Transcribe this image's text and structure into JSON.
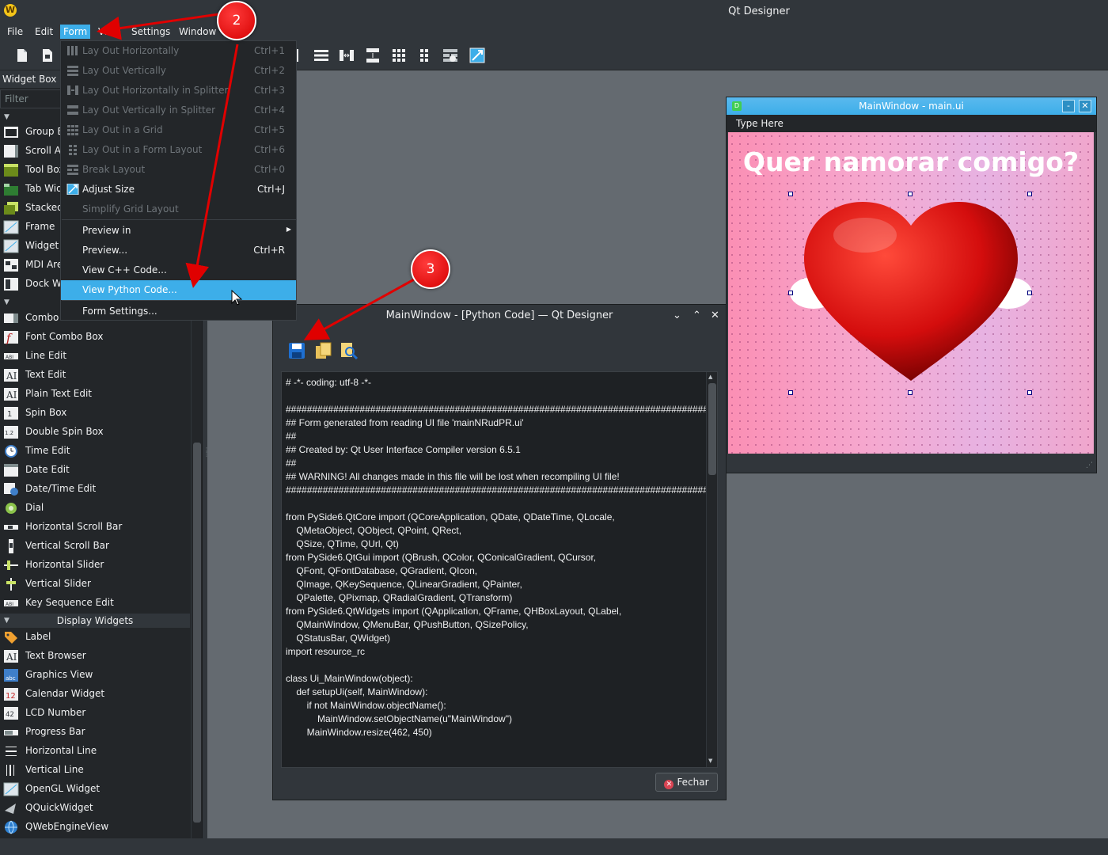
{
  "app": {
    "title": "Qt Designer",
    "icon": "qt-designer-icon"
  },
  "menubar": {
    "items": [
      "File",
      "Edit",
      "Form",
      "View",
      "Settings",
      "Window",
      "Help"
    ],
    "active": "Form"
  },
  "widget_box": {
    "title": "Widget Box",
    "filter_placeholder": "Filter",
    "items_top": [
      "Group Box",
      "Scroll Area",
      "Tool Box",
      "Tab Widget",
      "Stacked Widget",
      "Frame",
      "Widget",
      "MDI Area",
      "Dock Widget"
    ],
    "items_input": [
      "Combo Box",
      "Font Combo Box",
      "Line Edit",
      "Text Edit",
      "Plain Text Edit",
      "Spin Box",
      "Double Spin Box",
      "Time Edit",
      "Date Edit",
      "Date/Time Edit",
      "Dial",
      "Horizontal Scroll Bar",
      "Vertical Scroll Bar",
      "Horizontal Slider",
      "Vertical Slider",
      "Key Sequence Edit"
    ],
    "display_category": "Display Widgets",
    "items_display": [
      "Label",
      "Text Browser",
      "Graphics View",
      "Calendar Widget",
      "LCD Number",
      "Progress Bar",
      "Horizontal Line",
      "Vertical Line",
      "OpenGL Widget",
      "QQuickWidget",
      "QWebEngineView"
    ]
  },
  "form_menu": {
    "items": [
      {
        "label": "Lay Out Horizontally",
        "shortcut": "Ctrl+1",
        "enabled": false
      },
      {
        "label": "Lay Out Vertically",
        "shortcut": "Ctrl+2",
        "enabled": false
      },
      {
        "label": "Lay Out Horizontally in Splitter",
        "shortcut": "Ctrl+3",
        "enabled": false
      },
      {
        "label": "Lay Out Vertically in Splitter",
        "shortcut": "Ctrl+4",
        "enabled": false
      },
      {
        "label": "Lay Out in a Grid",
        "shortcut": "Ctrl+5",
        "enabled": false
      },
      {
        "label": "Lay Out in a Form Layout",
        "shortcut": "Ctrl+6",
        "enabled": false
      },
      {
        "label": "Break Layout",
        "shortcut": "Ctrl+0",
        "enabled": false
      },
      {
        "label": "Adjust Size",
        "shortcut": "Ctrl+J",
        "enabled": true
      },
      {
        "label": "Simplify Grid Layout",
        "shortcut": "",
        "enabled": false
      },
      {
        "label": "Preview in",
        "shortcut": "",
        "enabled": true
      },
      {
        "label": "Preview...",
        "shortcut": "Ctrl+R",
        "enabled": true
      },
      {
        "label": "View C++ Code...",
        "shortcut": "",
        "enabled": true
      },
      {
        "label": "View Python Code...",
        "shortcut": "",
        "enabled": true
      },
      {
        "label": "Form Settings...",
        "shortcut": "",
        "enabled": true
      }
    ],
    "highlighted": "View Python Code..."
  },
  "form_window": {
    "title": "MainWindow - main.ui",
    "menubar_placeholder": "Type Here",
    "heading": "Quer namorar comigo?",
    "colors": {
      "background_start": "#fb8fb4",
      "background_end": "#e7b2e2",
      "heart": "#d40d0d"
    }
  },
  "code_dialog": {
    "title": "MainWindow - [Python Code] — Qt Designer",
    "tools": [
      "save-icon",
      "copy-icon",
      "find-icon"
    ],
    "code_lines": [
      "# -*- coding: utf-8 -*-",
      "",
      "################################################################################",
      "## Form generated from reading UI file 'mainNRudPR.ui'",
      "##",
      "## Created by: Qt User Interface Compiler version 6.5.1",
      "##",
      "## WARNING! All changes made in this file will be lost when recompiling UI file!",
      "################################################################################",
      "",
      "from PySide6.QtCore import (QCoreApplication, QDate, QDateTime, QLocale,",
      "    QMetaObject, QObject, QPoint, QRect,",
      "    QSize, QTime, QUrl, Qt)",
      "from PySide6.QtGui import (QBrush, QColor, QConicalGradient, QCursor,",
      "    QFont, QFontDatabase, QGradient, QIcon,",
      "    QImage, QKeySequence, QLinearGradient, QPainter,",
      "    QPalette, QPixmap, QRadialGradient, QTransform)",
      "from PySide6.QtWidgets import (QApplication, QFrame, QHBoxLayout, QLabel,",
      "    QMainWindow, QMenuBar, QPushButton, QSizePolicy,",
      "    QStatusBar, QWidget)",
      "import resource_rc",
      "",
      "class Ui_MainWindow(object):",
      "    def setupUi(self, MainWindow):",
      "        if not MainWindow.objectName():",
      "            MainWindow.setObjectName(u\"MainWindow\")",
      "        MainWindow.resize(462, 450)"
    ],
    "close_label": "Fechar"
  },
  "annotations": {
    "step_2": "2",
    "step_3": "3",
    "color": "#e00000"
  }
}
